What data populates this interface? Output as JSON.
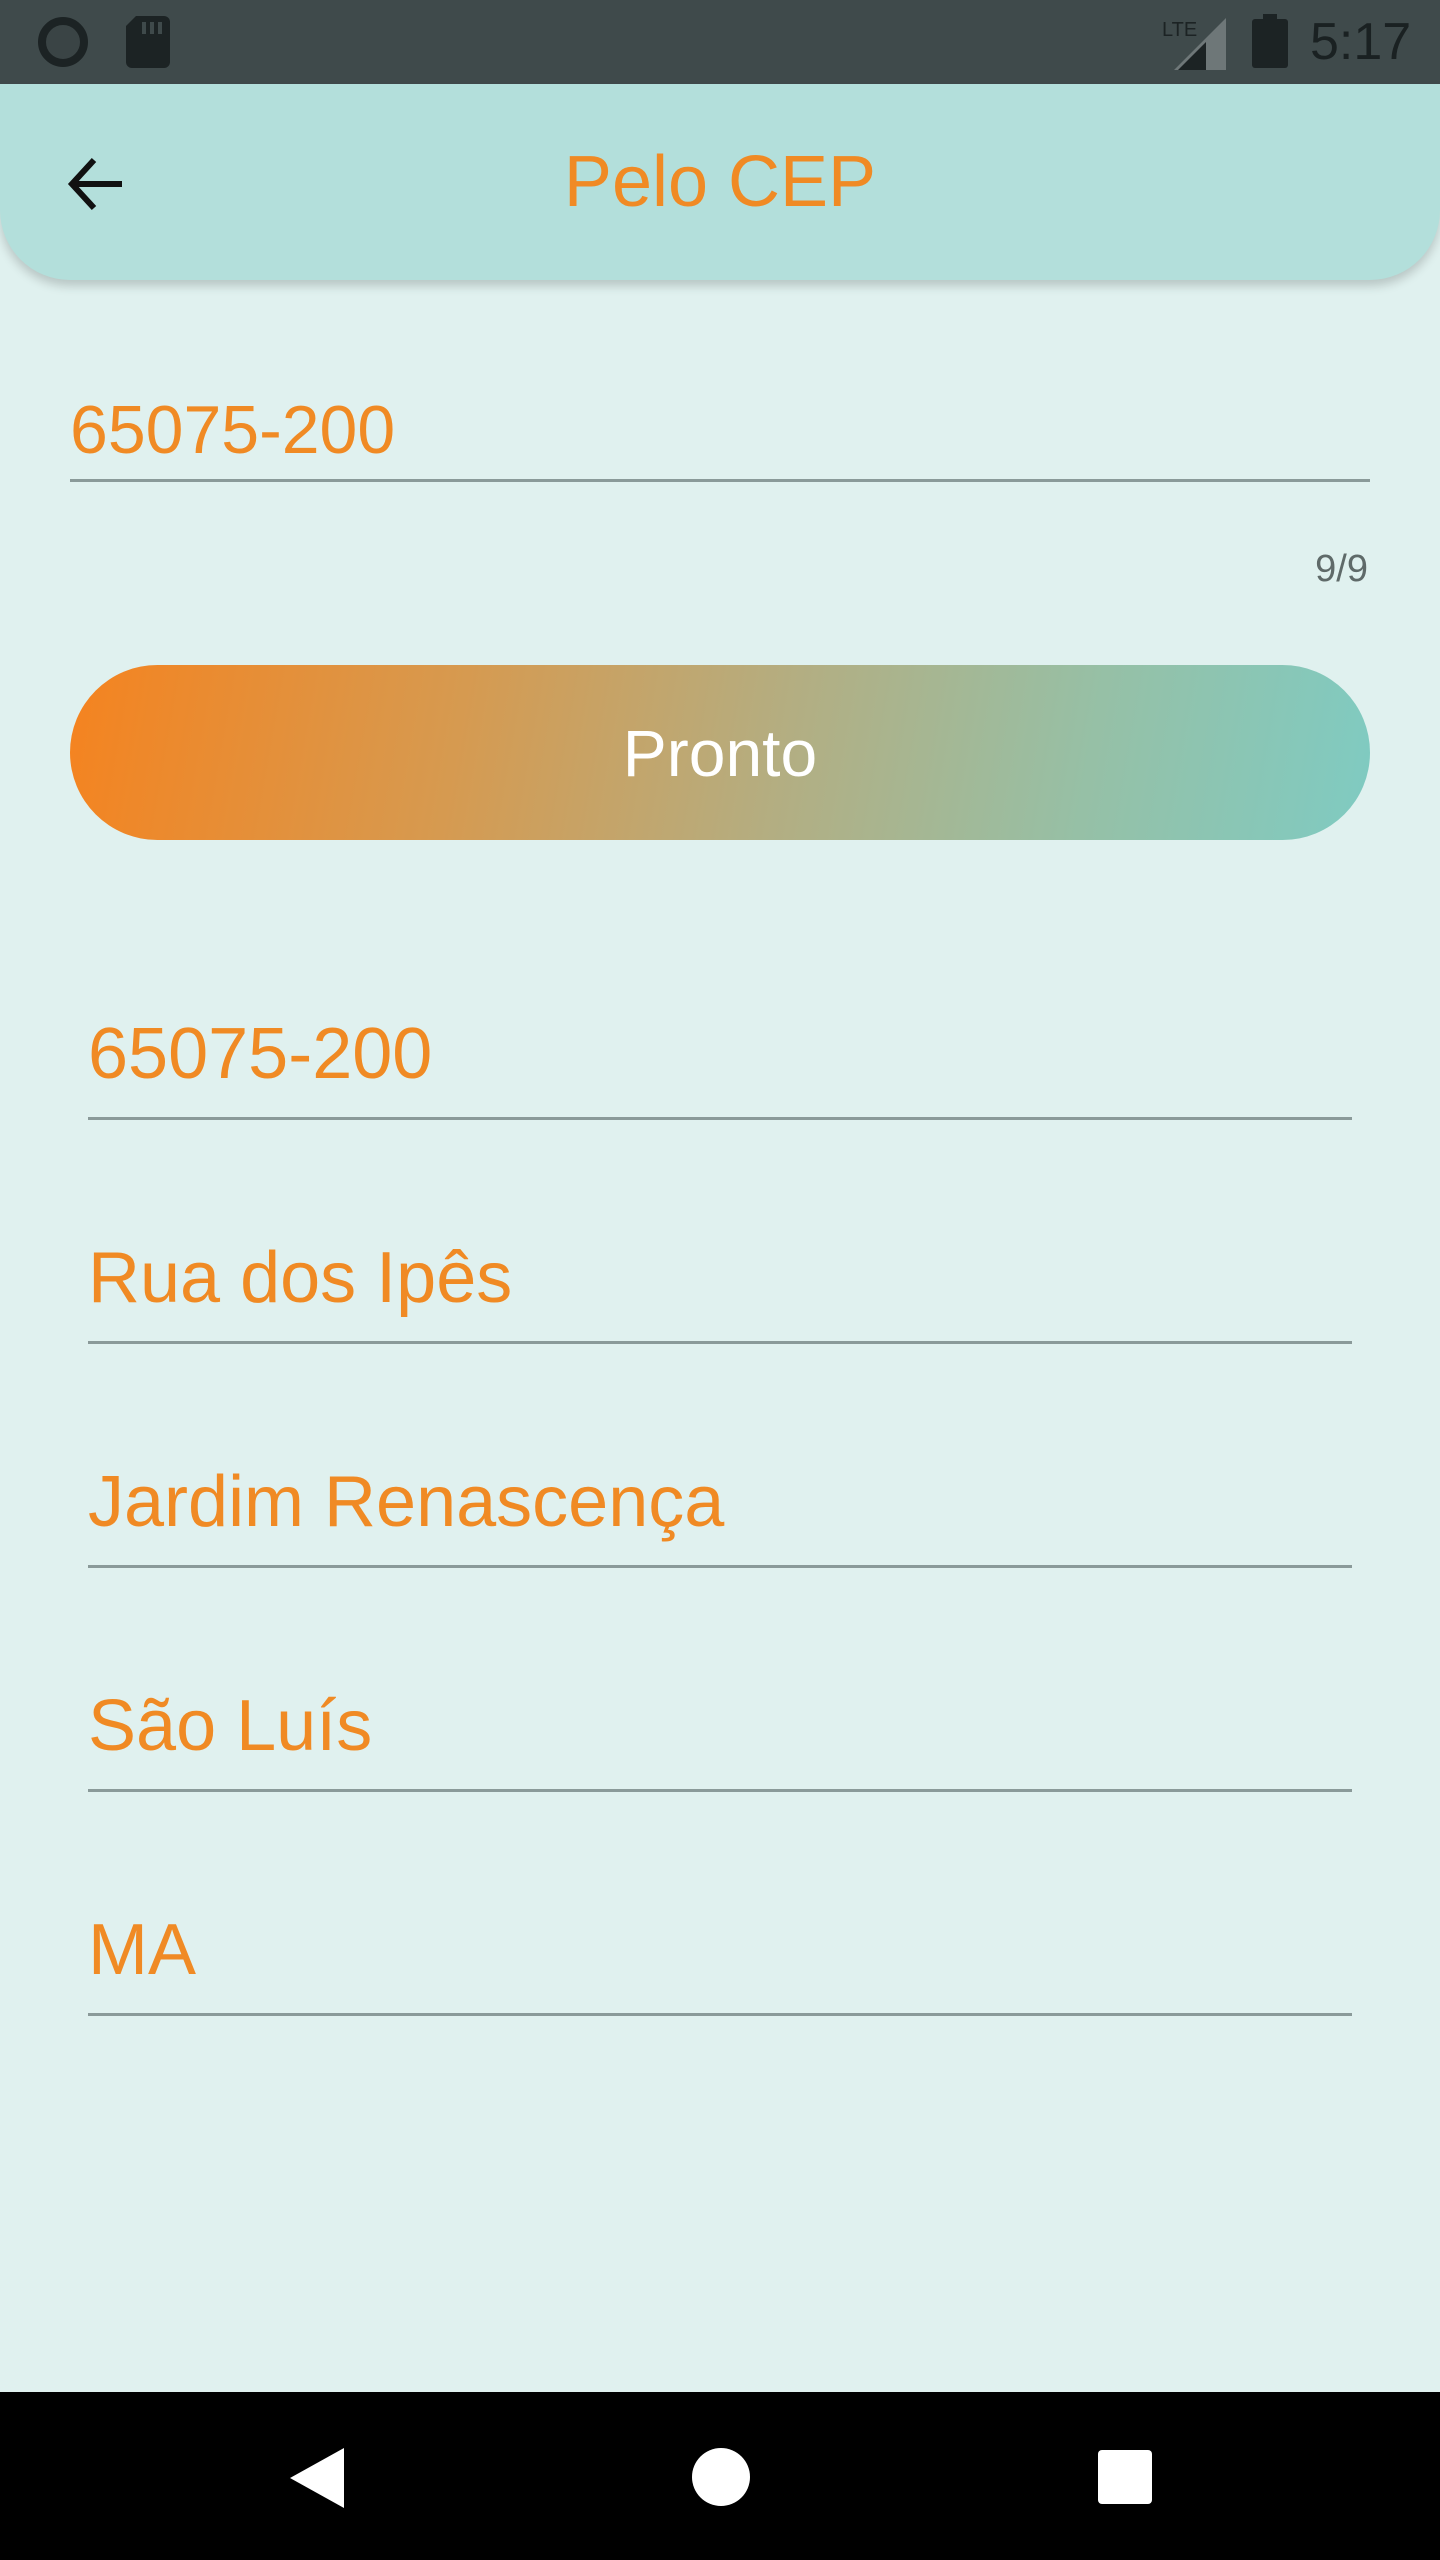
{
  "status_bar": {
    "time": "5:17",
    "network_label": "LTE",
    "icons": [
      "record-circle-icon",
      "sd-card-icon",
      "lte-signal-icon",
      "battery-icon"
    ]
  },
  "app_bar": {
    "title": "Pelo CEP",
    "back_icon": "arrow-left-icon"
  },
  "cep_input": {
    "value": "65075-200",
    "counter": "9/9"
  },
  "button": {
    "label": "Pronto"
  },
  "results": [
    "65075-200",
    "Rua dos Ipês",
    "Jardim Renascença",
    "São Luís",
    "MA"
  ],
  "navigation": {
    "icons": [
      "nav-back-icon",
      "nav-home-icon",
      "nav-recents-icon"
    ]
  },
  "colors": {
    "accent": "#f08a24",
    "app_bar": "#b3dfdb",
    "background": "#e0f1ef",
    "gradient_start": "#f5831f",
    "gradient_end": "#7fcbc2"
  }
}
